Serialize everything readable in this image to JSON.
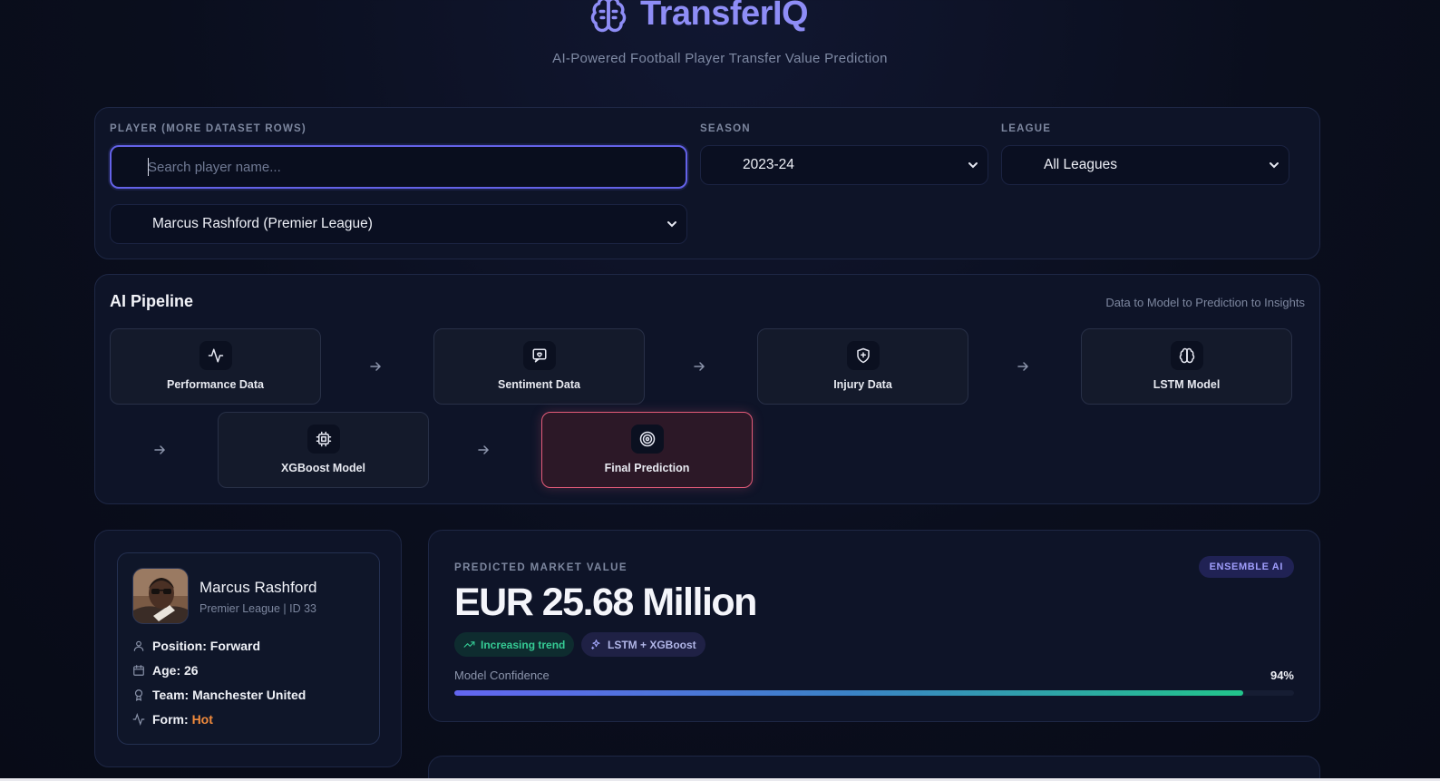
{
  "header": {
    "title": "TransferIQ",
    "subtitle": "AI-Powered Football Player Transfer Value Prediction",
    "logo_icon": "brain-icon",
    "accent": "#8e8df6"
  },
  "filters": {
    "player_label": "PLAYER (MORE DATASET ROWS)",
    "search_placeholder": "Search player name...",
    "player_selected": "Marcus Rashford (Premier League)",
    "season_label": "SEASON",
    "season_value": "2023-24",
    "league_label": "LEAGUE",
    "league_value": "All Leagues"
  },
  "pipeline": {
    "title": "AI Pipeline",
    "subtitle": "Data to Model to Prediction to Insights",
    "nodes": [
      {
        "label": "Performance Data",
        "icon": "activity-icon"
      },
      {
        "label": "Sentiment Data",
        "icon": "message-heart-icon"
      },
      {
        "label": "Injury Data",
        "icon": "shield-plus-icon"
      },
      {
        "label": "LSTM Model",
        "icon": "brain-icon"
      },
      {
        "label": "XGBoost Model",
        "icon": "cpu-icon"
      },
      {
        "label": "Final Prediction",
        "icon": "target-icon",
        "active": true
      }
    ],
    "active_color": "#e45b79"
  },
  "player": {
    "name": "Marcus Rashford",
    "meta": "Premier League | ID 33",
    "position_label": "Position: Forward",
    "age_label": "Age: 26",
    "team_label": "Team: Manchester United",
    "form_prefix": "Form: ",
    "form_value": "Hot",
    "form_color": "#f08a3c"
  },
  "prediction": {
    "label": "PREDICTED MARKET VALUE",
    "badge": "ENSEMBLE AI",
    "value": "EUR 25.68 Million",
    "trend_pill": "Increasing trend",
    "model_pill": "LSTM + XGBoost",
    "confidence_label": "Model Confidence",
    "confidence_text": "94%",
    "confidence": 0.94,
    "trend_color": "#35cc95"
  }
}
